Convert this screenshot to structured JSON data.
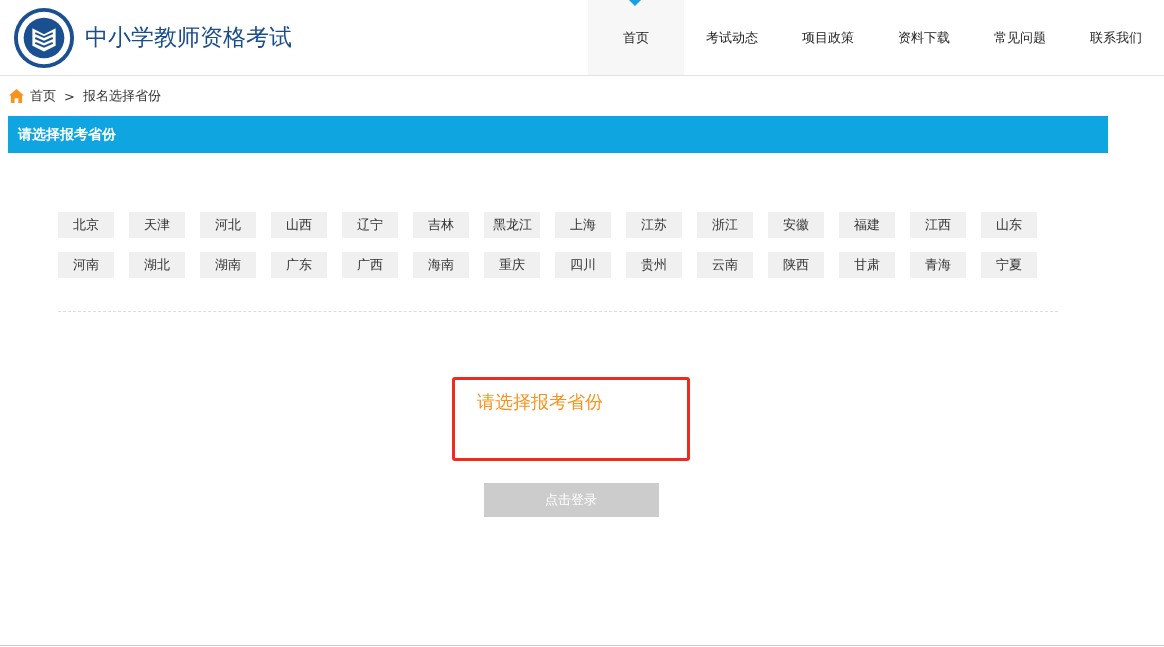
{
  "header": {
    "title": "中小学教师资格考试"
  },
  "nav": [
    {
      "label": "首页",
      "selected": true
    },
    {
      "label": "考试动态",
      "selected": false
    },
    {
      "label": "项目政策",
      "selected": false
    },
    {
      "label": "资料下载",
      "selected": false
    },
    {
      "label": "常见问题",
      "selected": false
    },
    {
      "label": "联系我们",
      "selected": false
    }
  ],
  "breadcrumb": {
    "items": [
      "首页",
      "报名选择省份"
    ],
    "separator": ">"
  },
  "section_title": "请选择报考省份",
  "provinces": [
    {
      "label": "北京",
      "selected": false
    },
    {
      "label": "天津",
      "selected": false
    },
    {
      "label": "河北",
      "selected": false
    },
    {
      "label": "山西",
      "selected": false
    },
    {
      "label": "辽宁",
      "selected": false
    },
    {
      "label": "吉林",
      "selected": false
    },
    {
      "label": "黑龙江",
      "selected": false
    },
    {
      "label": "上海",
      "selected": false
    },
    {
      "label": "江苏",
      "selected": false
    },
    {
      "label": "浙江",
      "selected": false
    },
    {
      "label": "安徽",
      "selected": false
    },
    {
      "label": "福建",
      "selected": false
    },
    {
      "label": "江西",
      "selected": false
    },
    {
      "label": "山东",
      "selected": false
    },
    {
      "label": "河南",
      "selected": false
    },
    {
      "label": "湖北",
      "selected": false
    },
    {
      "label": "湖南",
      "selected": false
    },
    {
      "label": "广东",
      "selected": false
    },
    {
      "label": "广西",
      "selected": false
    },
    {
      "label": "海南",
      "selected": false
    },
    {
      "label": "重庆",
      "selected": false
    },
    {
      "label": "四川",
      "selected": false
    },
    {
      "label": "贵州",
      "selected": false
    },
    {
      "label": "云南",
      "selected": false
    },
    {
      "label": "陕西",
      "selected": false
    },
    {
      "label": "甘肃",
      "selected": false
    },
    {
      "label": "青海",
      "selected": false
    },
    {
      "label": "宁夏",
      "selected": false
    }
  ],
  "prompt": "请选择报考省份",
  "login_button": {
    "label": "点击登录",
    "disabled": true
  }
}
